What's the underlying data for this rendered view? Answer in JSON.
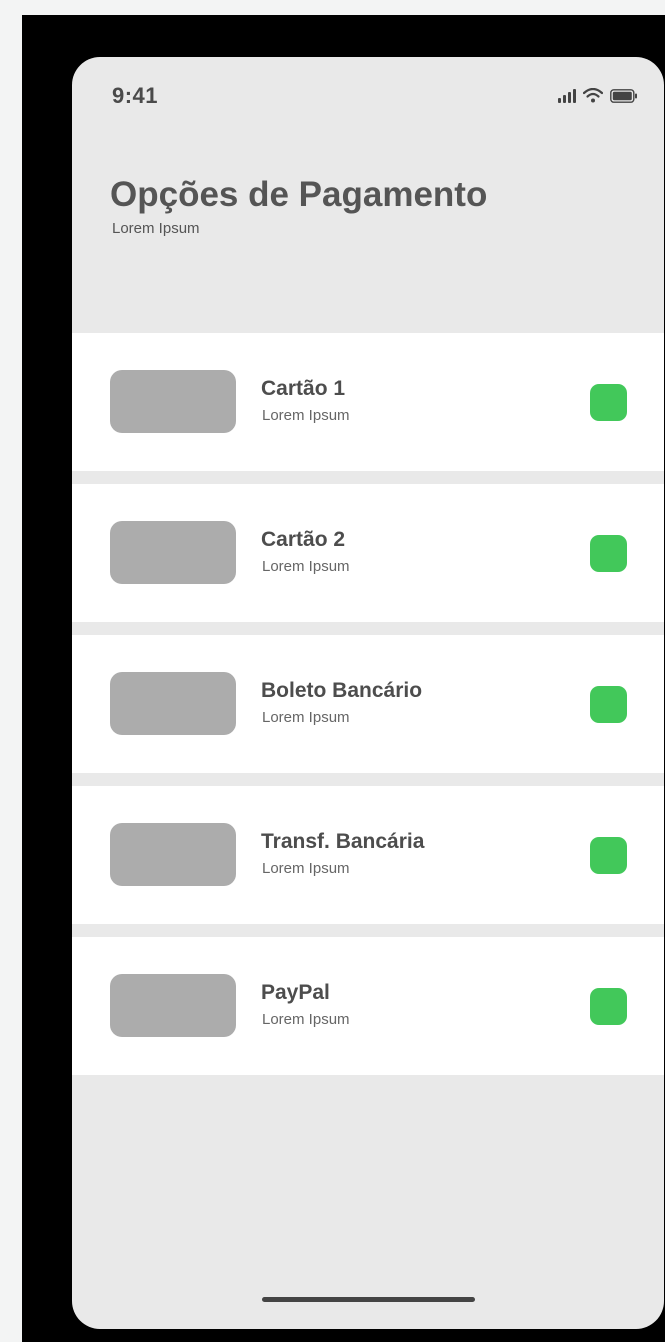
{
  "status_bar": {
    "time": "9:41",
    "icons": [
      "cellular-signal-icon",
      "wifi-icon",
      "battery-icon"
    ]
  },
  "header": {
    "title": "Opções de Pagamento",
    "subtitle": "Lorem Ipsum"
  },
  "options": [
    {
      "name": "Cartão 1",
      "description": "Lorem Ipsum"
    },
    {
      "name": "Cartão 2",
      "description": "Lorem Ipsum"
    },
    {
      "name": "Boleto Bancário",
      "description": "Lorem Ipsum"
    },
    {
      "name": "Transf. Bancária",
      "description": "Lorem Ipsum"
    },
    {
      "name": "PayPal",
      "description": "Lorem Ipsum"
    }
  ],
  "colors": {
    "accent": "#42c85a",
    "placeholder": "#acacac",
    "background": "#e9e9e9"
  }
}
